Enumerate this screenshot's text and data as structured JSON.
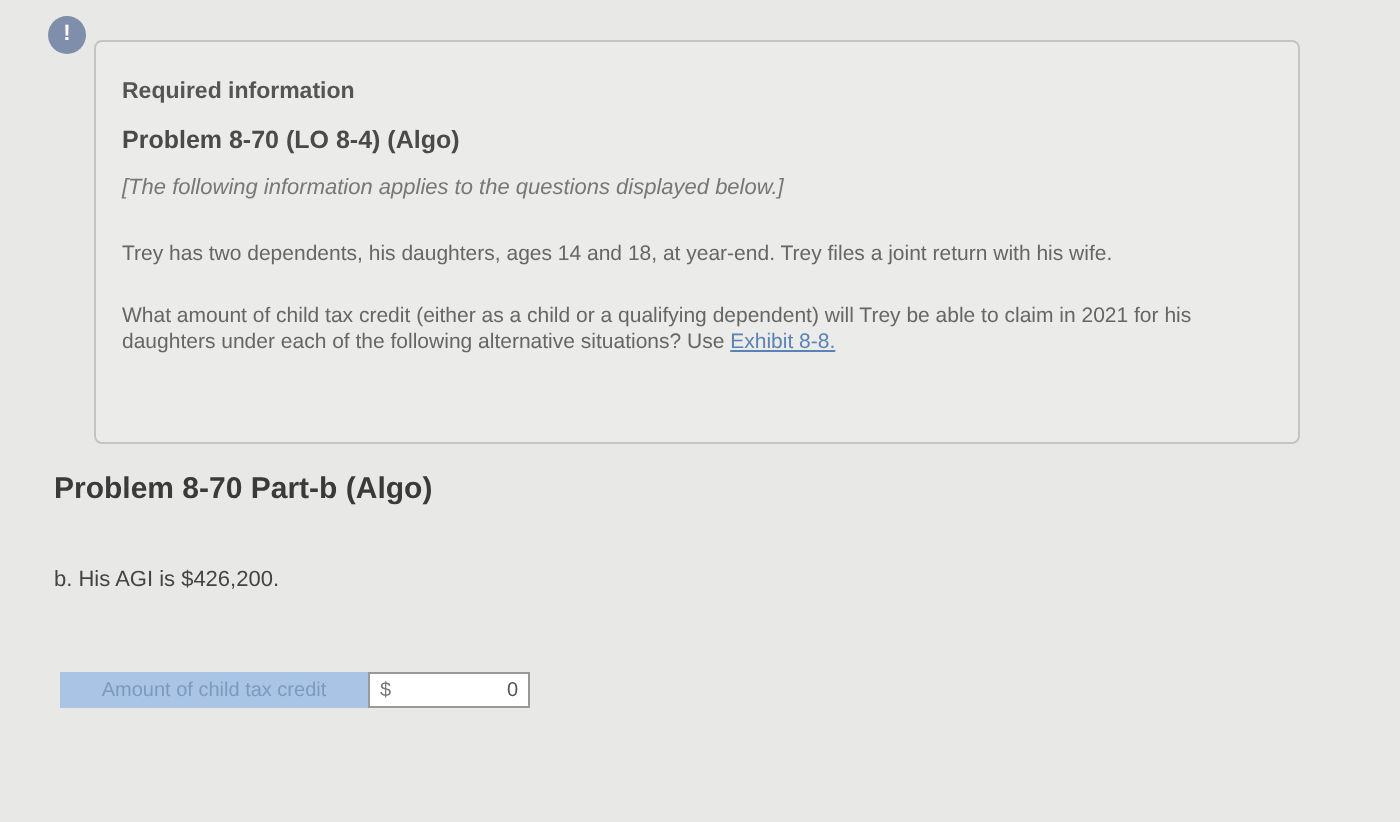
{
  "alert_icon": "!",
  "info": {
    "heading": "Required information",
    "problem": "Problem 8-70 (LO 8-4) (Algo)",
    "note": "[The following information applies to the questions displayed below.]",
    "paragraphs": [
      "Trey has two dependents, his daughters, ages 14 and 18, at year-end. Trey files a joint return with his wife.",
      "What amount of child tax credit (either as a child or a qualifying dependent) will Trey be able to claim in 2021 for his daughters under each of the following alternative situations? Use"
    ],
    "link": "Exhibit 8-8."
  },
  "part_title": "Problem 8-70 Part-b (Algo)",
  "question": "b. His AGI is $426,200.",
  "answer": {
    "label": "Amount of child tax credit",
    "currency": "$",
    "value": "0"
  }
}
